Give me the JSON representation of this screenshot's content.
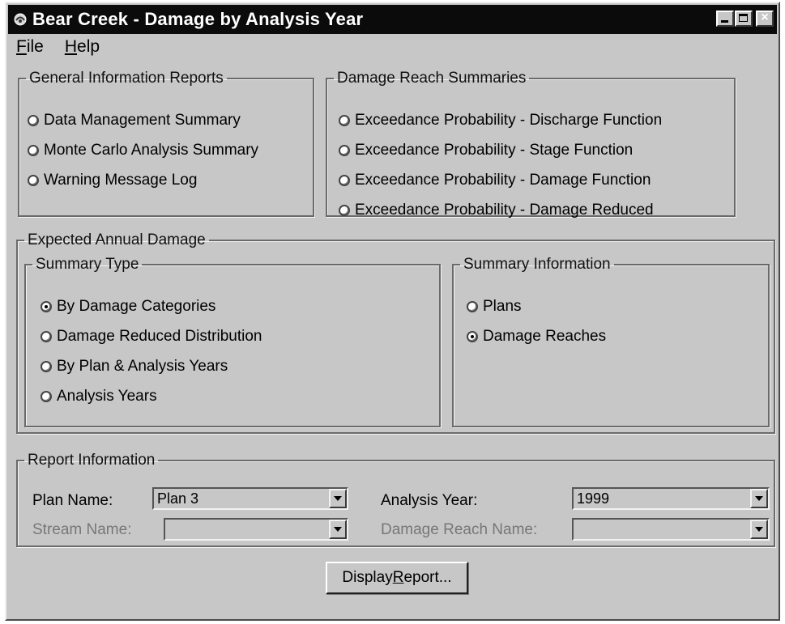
{
  "window": {
    "title": "Bear Creek - Damage by Analysis Year",
    "icon": "app-icon",
    "buttons": [
      "minimize-icon",
      "maximize-icon",
      "close-icon"
    ]
  },
  "menu": {
    "file": {
      "mnemonic": "F",
      "rest": "ile"
    },
    "help": {
      "mnemonic": "H",
      "rest": "elp"
    }
  },
  "general_info": {
    "legend": "General Information Reports",
    "options": [
      {
        "label": "Data Management Summary",
        "checked": false
      },
      {
        "label": "Monte Carlo Analysis Summary",
        "checked": false
      },
      {
        "label": "Warning Message Log",
        "checked": false
      }
    ]
  },
  "damage_reach": {
    "legend": "Damage Reach Summaries",
    "options": [
      {
        "label": "Exceedance Probability - Discharge Function",
        "checked": false
      },
      {
        "label": "Exceedance Probability - Stage Function",
        "checked": false
      },
      {
        "label": "Exceedance Probability - Damage Function",
        "checked": false
      },
      {
        "label": "Exceedance Probability - Damage Reduced",
        "checked": false
      }
    ]
  },
  "ead": {
    "legend": "Expected Annual Damage",
    "summary_type": {
      "legend": "Summary Type",
      "options": [
        {
          "label": "By Damage Categories",
          "checked": true
        },
        {
          "label": "Damage Reduced Distribution",
          "checked": false
        },
        {
          "label": "By Plan & Analysis Years",
          "checked": false
        },
        {
          "label": "Analysis Years",
          "checked": false
        }
      ]
    },
    "summary_info": {
      "legend": "Summary Information",
      "options": [
        {
          "label": "Plans",
          "checked": false
        },
        {
          "label": "Damage Reaches",
          "checked": true
        }
      ]
    }
  },
  "report_info": {
    "legend": "Report Information",
    "plan_name": {
      "label": "Plan Name:",
      "value": "Plan 3"
    },
    "analysis_year": {
      "label": "Analysis Year:",
      "value": "1999"
    },
    "stream_name": {
      "label": "Stream Name:",
      "value": ""
    },
    "damage_reach_name": {
      "label": "Damage Reach Name:",
      "value": ""
    }
  },
  "display_button": {
    "pre": "Display ",
    "mnemonic": "R",
    "post": "eport..."
  }
}
